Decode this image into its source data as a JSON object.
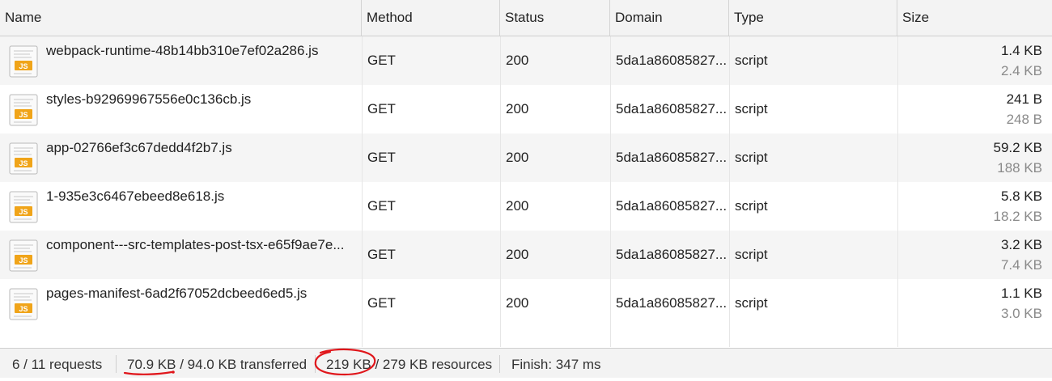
{
  "columns": [
    "Name",
    "Method",
    "Status",
    "Domain",
    "Type",
    "Size"
  ],
  "icons": {
    "file": "js-file-icon",
    "file_badge": "JS"
  },
  "colors": {
    "annotation": "#e0161b",
    "icon_badge": "#f0a419",
    "icon_badge_text": "#ffffff"
  },
  "rows": [
    {
      "name": "webpack-runtime-48b14bb310e7ef02a286.js",
      "method": "GET",
      "status": "200",
      "domain": "5da1a86085827...",
      "type": "script",
      "size": "1.4 KB",
      "resource_size": "2.4 KB"
    },
    {
      "name": "styles-b92969967556e0c136cb.js",
      "method": "GET",
      "status": "200",
      "domain": "5da1a86085827...",
      "type": "script",
      "size": "241 B",
      "resource_size": "248 B"
    },
    {
      "name": "app-02766ef3c67dedd4f2b7.js",
      "method": "GET",
      "status": "200",
      "domain": "5da1a86085827...",
      "type": "script",
      "size": "59.2 KB",
      "resource_size": "188 KB"
    },
    {
      "name": "1-935e3c6467ebeed8e618.js",
      "method": "GET",
      "status": "200",
      "domain": "5da1a86085827...",
      "type": "script",
      "size": "5.8 KB",
      "resource_size": "18.2 KB"
    },
    {
      "name": "component---src-templates-post-tsx-e65f9ae7e...",
      "method": "GET",
      "status": "200",
      "domain": "5da1a86085827...",
      "type": "script",
      "size": "3.2 KB",
      "resource_size": "7.4 KB"
    },
    {
      "name": "pages-manifest-6ad2f67052dcbeed6ed5.js",
      "method": "GET",
      "status": "200",
      "domain": "5da1a86085827...",
      "type": "script",
      "size": "1.1 KB",
      "resource_size": "3.0 KB"
    }
  ],
  "footer": {
    "requests": "6 / 11 requests",
    "transferred_value": "70.9 KB",
    "transferred_rest": " / 94.0 KB transferred",
    "resources_value": "219 KB",
    "resources_rest": " / 279 KB resources",
    "finish": "Finish: 347 ms"
  }
}
